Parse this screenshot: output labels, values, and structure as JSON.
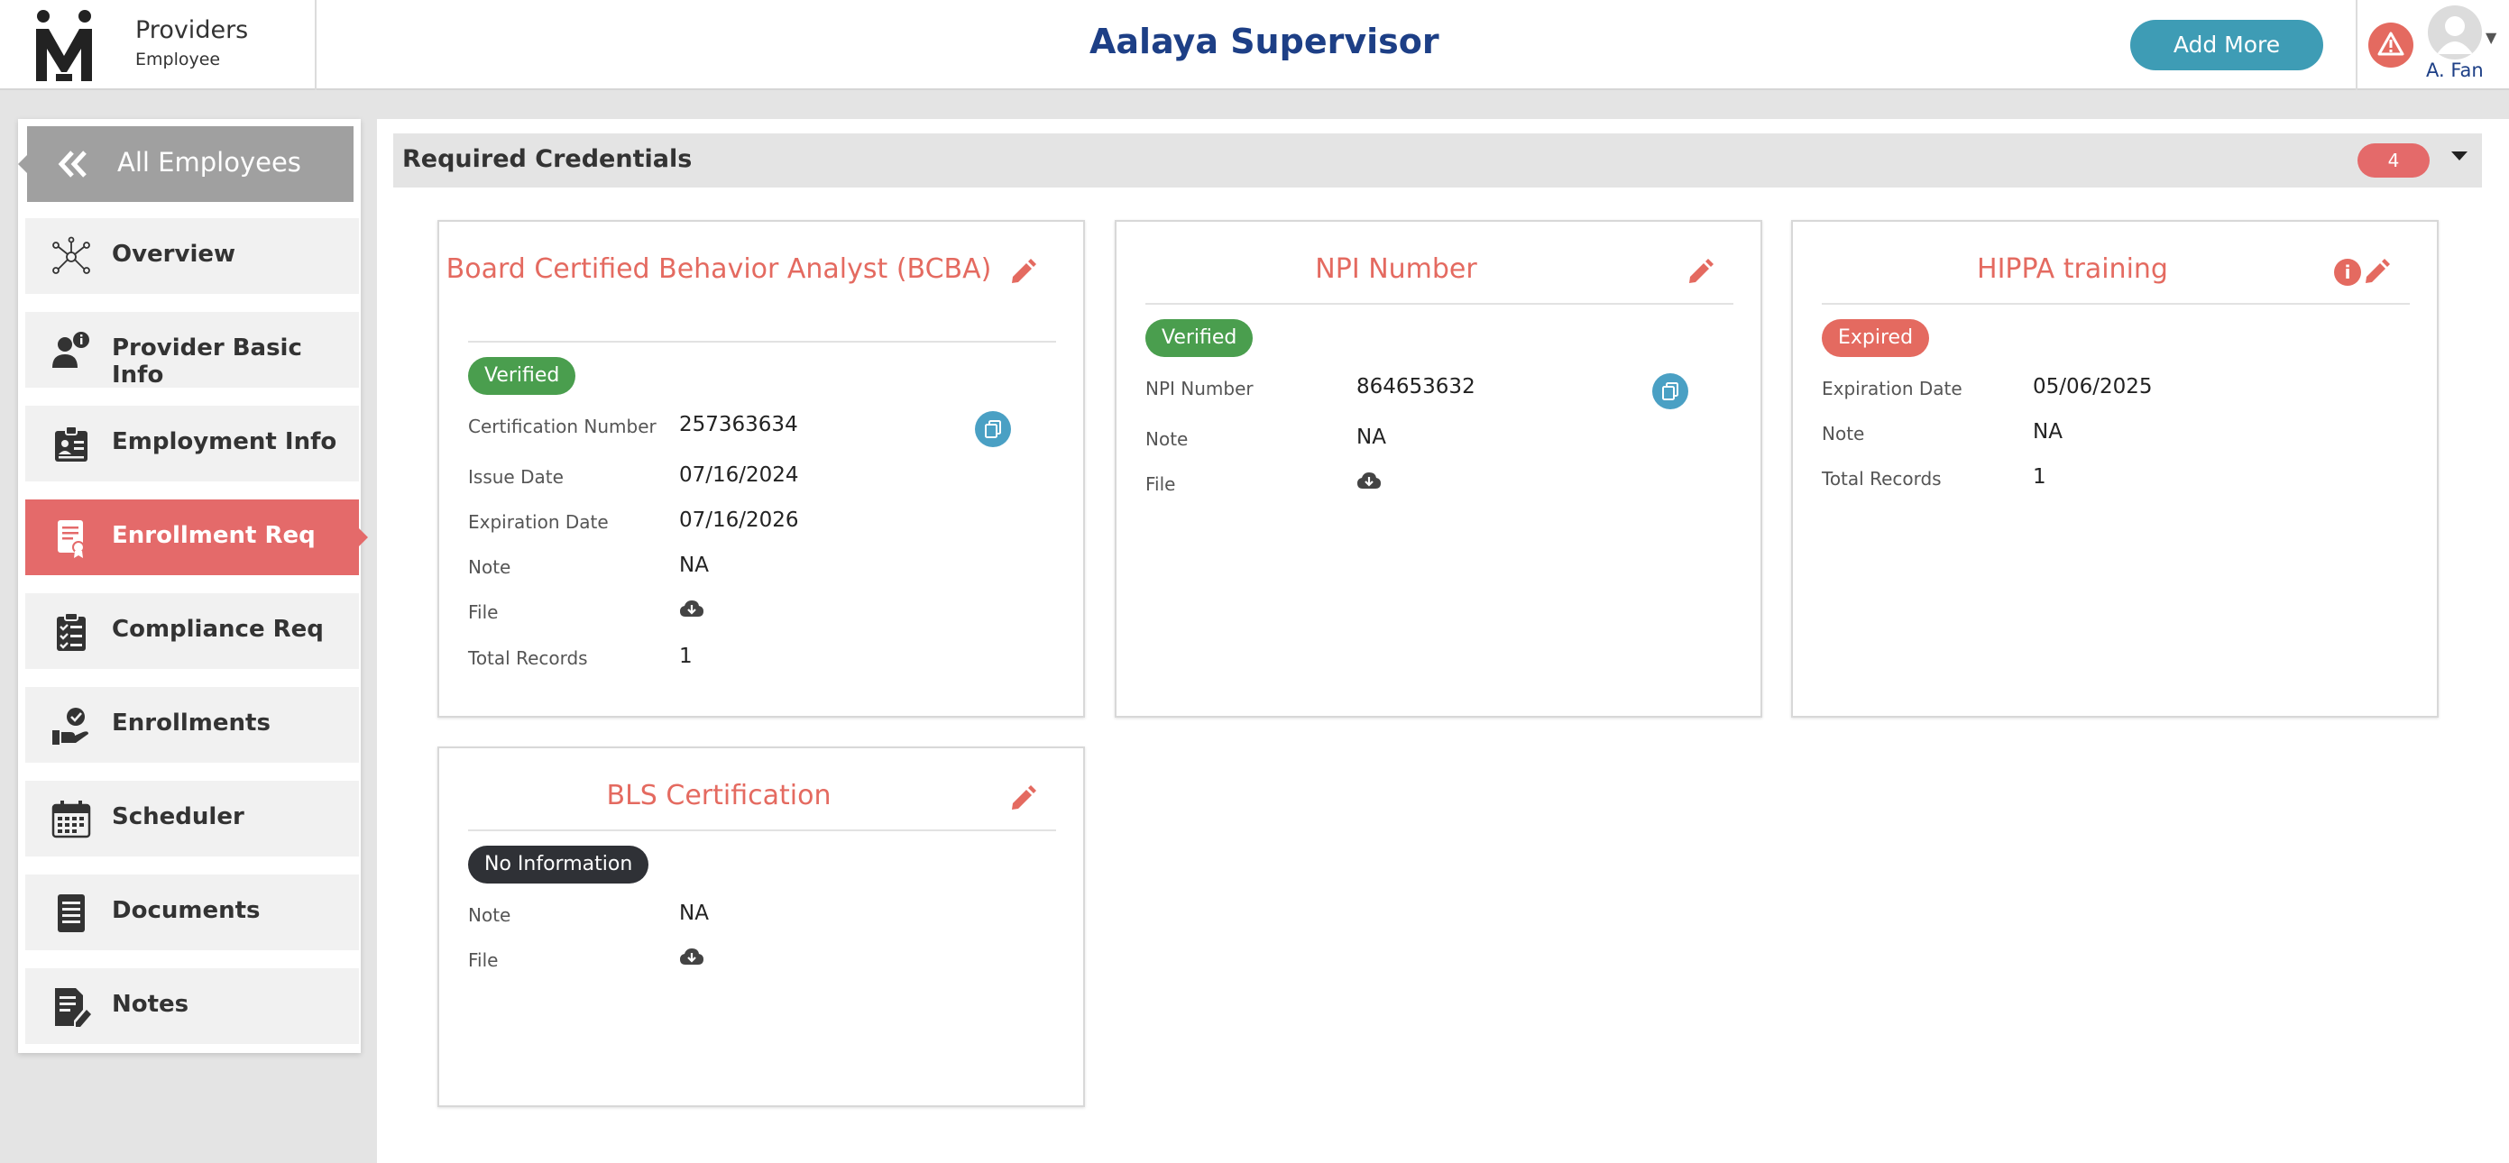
{
  "header": {
    "brand_title": "Providers",
    "brand_subtitle": "Employee",
    "page_title": "Aalaya Supervisor",
    "add_more_label": "Add More",
    "user_name": "A. Fan",
    "colors": {
      "title": "#1d3f86",
      "add_button": "#3e9cb5",
      "warning": "#e46a60"
    }
  },
  "sidebar": {
    "back_label": "All Employees",
    "items": [
      {
        "label": "Overview",
        "icon": "network-icon",
        "active": false
      },
      {
        "label": "Provider Basic Info",
        "icon": "user-info-icon",
        "active": false
      },
      {
        "label": "Employment Info",
        "icon": "id-badge-icon",
        "active": false
      },
      {
        "label": "Enrollment Req",
        "icon": "certificate-icon",
        "active": true
      },
      {
        "label": "Compliance Req",
        "icon": "checklist-icon",
        "active": false
      },
      {
        "label": "Enrollments",
        "icon": "hand-check-icon",
        "active": false
      },
      {
        "label": "Scheduler",
        "icon": "calendar-icon",
        "active": false
      },
      {
        "label": "Documents",
        "icon": "document-icon",
        "active": false
      },
      {
        "label": "Notes",
        "icon": "note-edit-icon",
        "active": false
      }
    ],
    "active_color": "#e46a6a"
  },
  "section": {
    "title": "Required Credentials",
    "count": "4"
  },
  "cards": [
    {
      "title": "Board Certified Behavior Analyst (BCBA)",
      "status": "Verified",
      "status_color": "#4a9e4e",
      "rows": [
        {
          "label": "Certification Number",
          "value": "257363634"
        },
        {
          "label": "Issue Date",
          "value": "07/16/2024"
        },
        {
          "label": "Expiration Date",
          "value": "07/16/2026"
        },
        {
          "label": "Note",
          "value": "NA"
        },
        {
          "label": "File",
          "value": ""
        },
        {
          "label": "Total Records",
          "value": "1"
        }
      ]
    },
    {
      "title": "NPI Number",
      "status": "Verified",
      "status_color": "#4a9e4e",
      "rows": [
        {
          "label": "NPI Number",
          "value": "864653632"
        },
        {
          "label": "Note",
          "value": "NA"
        },
        {
          "label": "File",
          "value": ""
        }
      ]
    },
    {
      "title": "HIPPA training",
      "status": "Expired",
      "status_color": "#e46a60",
      "rows": [
        {
          "label": "Expiration Date",
          "value": "05/06/2025"
        },
        {
          "label": "Note",
          "value": "NA"
        },
        {
          "label": "Total Records",
          "value": "1"
        }
      ]
    },
    {
      "title": "BLS Certification",
      "status": "No Information",
      "status_color": "#2f3136",
      "rows": [
        {
          "label": "Note",
          "value": "NA"
        },
        {
          "label": "File",
          "value": ""
        }
      ]
    }
  ]
}
